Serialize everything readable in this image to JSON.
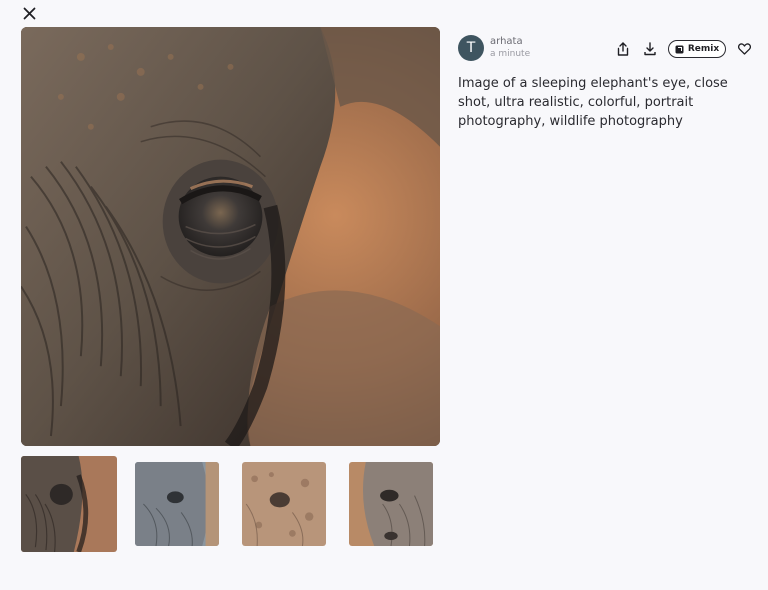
{
  "author": {
    "initial": "T",
    "name": "arhata",
    "time": "a minute"
  },
  "actions": {
    "share_icon": "share-icon",
    "download_icon": "download-icon",
    "remix_label": "Remix",
    "remix_icon": "remix-icon",
    "like_icon": "heart-icon"
  },
  "prompt": "Image of a sleeping elephant's eye, close shot, ultra realistic, colorful, portrait photography, wildlife photography",
  "thumbnails": [
    {
      "selected": true
    },
    {
      "selected": false
    },
    {
      "selected": false
    },
    {
      "selected": false
    }
  ],
  "colors": {
    "avatar": "#3f5560",
    "background": "#f8f8fb",
    "text": "#2a2a30"
  }
}
